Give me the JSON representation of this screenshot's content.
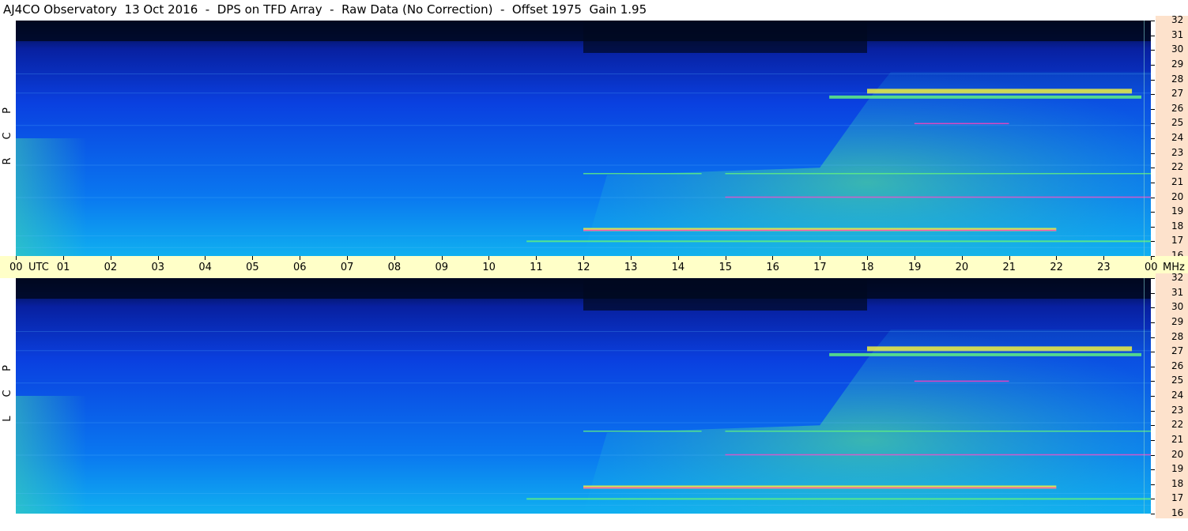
{
  "title": "AJ4CO Observatory  13 Oct 2016  -  DPS on TFD Array  -  Raw Data (No Correction)  -  Offset 1975  Gain 1.95",
  "panels": [
    {
      "label_letters": [
        "R",
        "C",
        "P"
      ]
    },
    {
      "label_letters": [
        "L",
        "C",
        "P"
      ]
    }
  ],
  "time_axis": {
    "labels": [
      "00",
      "01",
      "02",
      "03",
      "04",
      "05",
      "06",
      "07",
      "08",
      "09",
      "10",
      "11",
      "12",
      "13",
      "14",
      "15",
      "16",
      "17",
      "18",
      "19",
      "20",
      "21",
      "22",
      "23",
      "00"
    ],
    "utc_label": "UTC",
    "unit_label": "MHz"
  },
  "freq_axis": {
    "labels": [
      "32",
      "31",
      "30",
      "29",
      "28",
      "27",
      "26",
      "25",
      "24",
      "23",
      "22",
      "21",
      "20",
      "19",
      "18",
      "17",
      "16"
    ]
  },
  "colors": {
    "background_low": "#000820",
    "background_mid": "#0a40e0",
    "background_cyan": "#10b0f0",
    "emission_green": "#60f080",
    "emission_yellow": "#f0f040",
    "emission_magenta": "#ff40c0",
    "axis_band": "#ffffc8",
    "freq_band": "#fde2cc"
  },
  "chart_data": {
    "type": "heatmap",
    "title": "AJ4CO Observatory  13 Oct 2016  -  DPS on TFD Array  -  Raw Data (No Correction)  -  Offset 1975  Gain 1.95",
    "xlabel": "UTC",
    "ylabel": "MHz",
    "x_range_hours": [
      0,
      24
    ],
    "y_range_mhz": [
      16,
      32
    ],
    "panels": [
      "RCP",
      "LCP"
    ],
    "bright_bands_mhz": [
      27.2,
      17.8,
      17.0,
      21.6,
      20.0,
      25.0
    ],
    "emission_onset_utc_hours": [
      12,
      18
    ]
  }
}
